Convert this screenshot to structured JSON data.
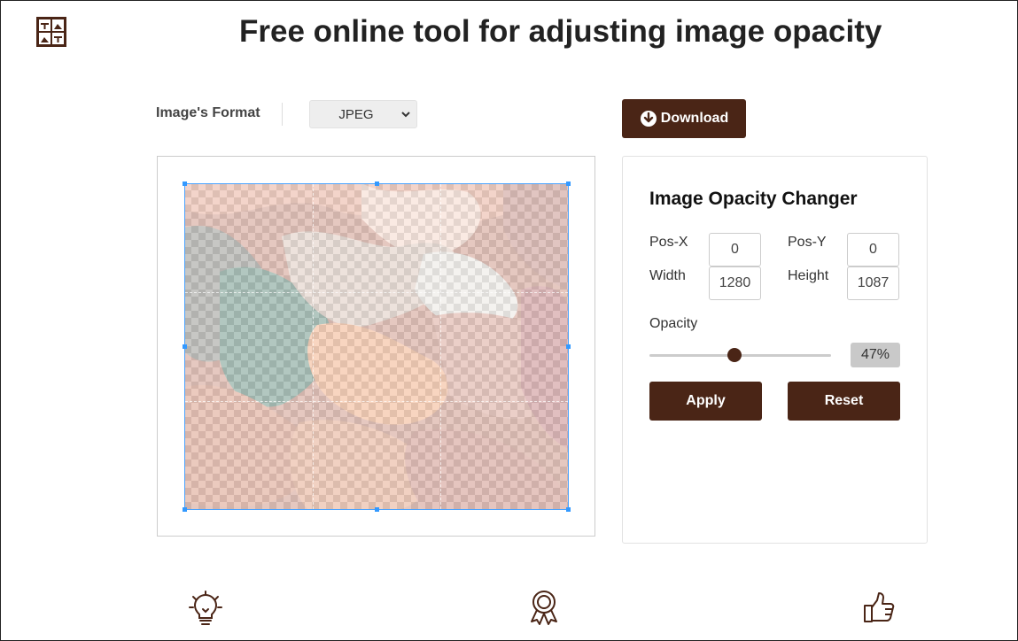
{
  "header": {
    "title": "Free online tool for adjusting image opacity",
    "logo_icon": "image-grid-logo"
  },
  "toolbar": {
    "format_label": "Image's Format",
    "format_value": "JPEG",
    "download_label": "Download"
  },
  "panel": {
    "title": "Image Opacity Changer",
    "pos_x_label": "Pos-X",
    "pos_x_value": "0",
    "pos_y_label": "Pos-Y",
    "pos_y_value": "0",
    "width_label": "Width",
    "width_value": "1280",
    "height_label": "Height",
    "height_value": "1087",
    "opacity_label": "Opacity",
    "opacity_value": 0.47,
    "opacity_display": "47%",
    "apply_label": "Apply",
    "reset_label": "Reset"
  },
  "features": [
    {
      "icon": "lightbulb-icon"
    },
    {
      "icon": "award-ribbon-icon"
    },
    {
      "icon": "thumbs-up-icon"
    }
  ],
  "colors": {
    "brand": "#4a2516",
    "selection": "#4aa3ff"
  }
}
